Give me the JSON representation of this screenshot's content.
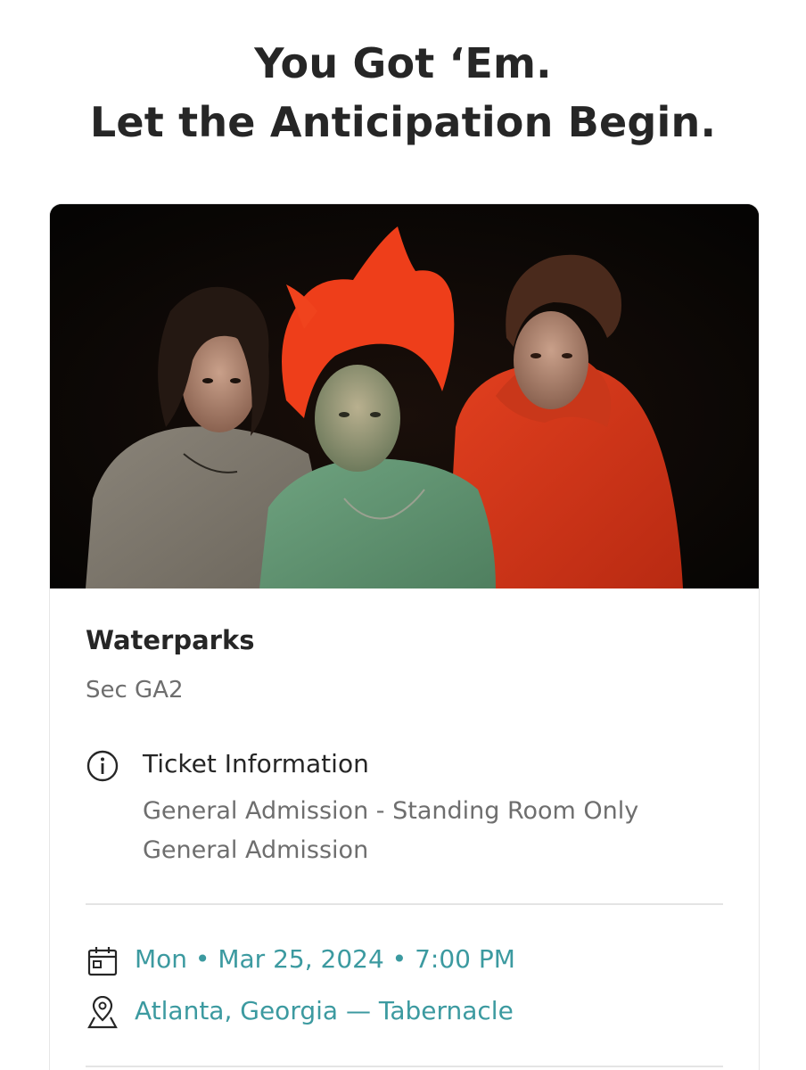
{
  "header": {
    "line1": "You Got ‘Em.",
    "line2": "Let the Anticipation Begin."
  },
  "event": {
    "artist": "Waterparks",
    "section": "Sec GA2",
    "ticket_info": {
      "title": "Ticket Information",
      "line1": "General Admission - Standing Room Only",
      "line2": "General Admission"
    },
    "datetime": "Mon • Mar 25, 2024 • 7:00 PM",
    "location": "Atlanta, Georgia — Tabernacle"
  },
  "icons": {
    "info": "info-circle-icon",
    "date": "calendar-icon",
    "location": "map-pin-icon"
  },
  "colors": {
    "accent_teal": "#3c9aa0",
    "hero_background": "#070504"
  }
}
